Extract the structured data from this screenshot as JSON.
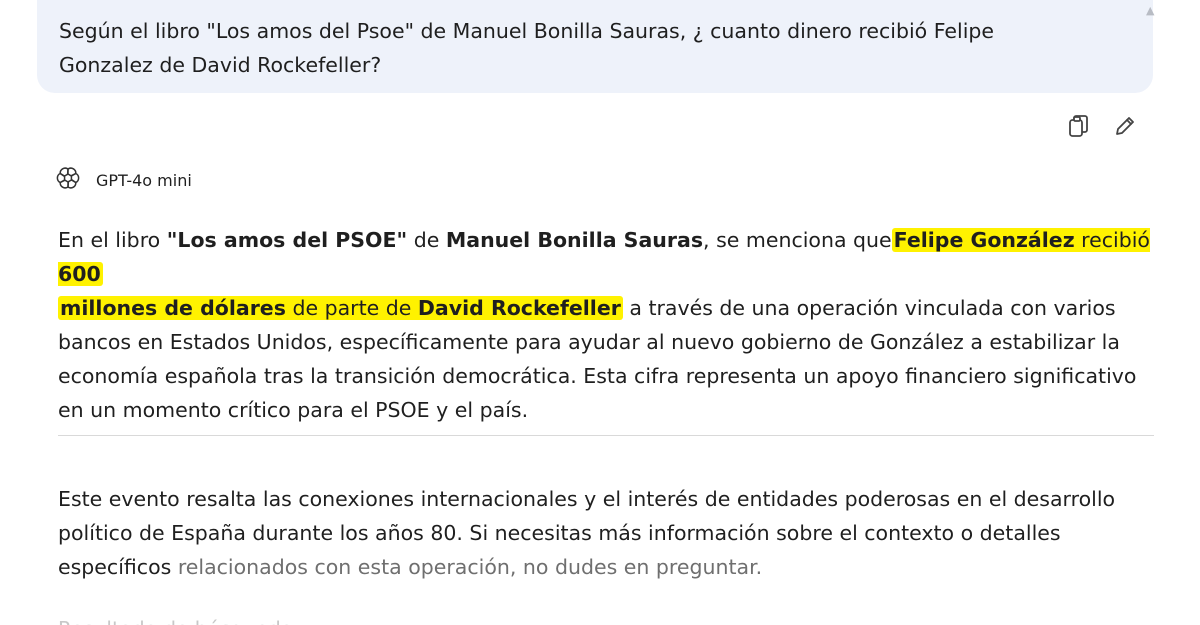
{
  "user_message": {
    "text": "Según el libro \"Los amos del Psoe\" de Manuel Bonilla Sauras, ¿ cuanto dinero recibió Felipe Gonzalez de David Rockefeller?"
  },
  "actions": {
    "copy_icon": "copy-icon",
    "edit_icon": "edit-pencil-icon"
  },
  "model": {
    "name": "GPT-4o mini",
    "icon": "openai-logo-icon"
  },
  "answer": {
    "p1": {
      "s1": "En el libro ",
      "s2": "\"Los amos del PSOE\"",
      "s3": " de ",
      "s4": "Manuel Bonilla Sauras",
      "s5": ", se menciona que",
      "s6": "Felipe González",
      "s7": " recibió ",
      "s8": "600",
      "s9": "millones de dólares",
      "s10": " de parte de ",
      "s11": "David Rockefeller",
      "s12": " a través de una operación vinculada con varios bancos en Estados Unidos, específicamente para ayudar al nuevo gobierno de González a estabilizar la economía española tras la transición democrática. Esta cifra representa un apoyo financiero significativo en un momento crítico para el PSOE y el país."
    },
    "p2": {
      "main": "Este evento resalta las conexiones internacionales y el interés de entidades poderosas en el desarrollo político de España durante los años 80. Si necesitas más información sobre el contexto o detalles específicos ",
      "faded": "relacionados con esta operación, no dudes en preguntar."
    },
    "faded_tail": "Resultado de búsqueda"
  },
  "colors": {
    "highlight": "#fff200",
    "user_bubble": "#eef2fa"
  }
}
